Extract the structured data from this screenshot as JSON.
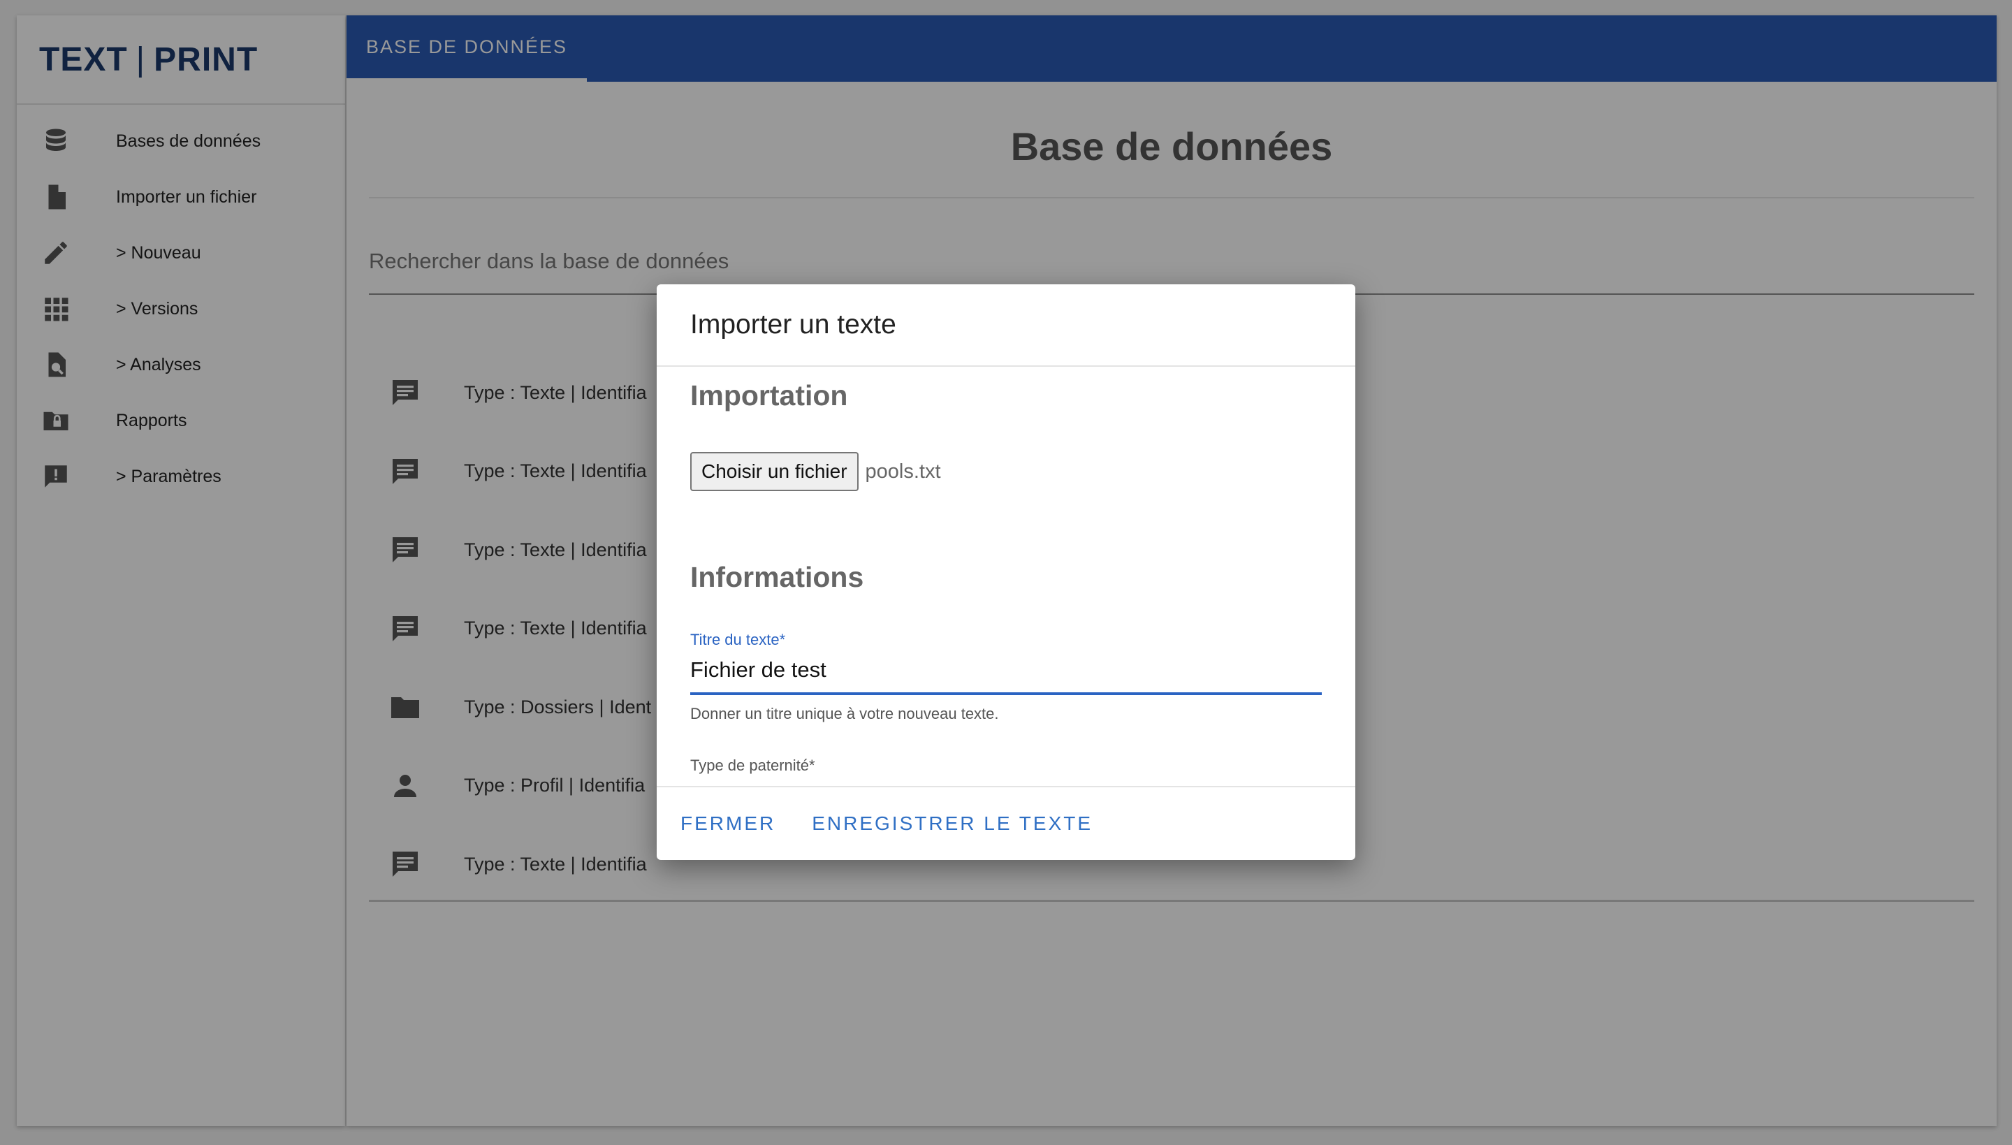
{
  "app": {
    "logo_left": "TEXT",
    "logo_sep": "|",
    "logo_right": "PRINT"
  },
  "sidebar": {
    "items": [
      {
        "label": "Bases de données",
        "icon": "database-icon"
      },
      {
        "label": "Importer un fichier",
        "icon": "file-icon"
      },
      {
        "label": "> Nouveau",
        "icon": "pencil-icon"
      },
      {
        "label": "> Versions",
        "icon": "grid-icon"
      },
      {
        "label": "> Analyses",
        "icon": "search-document-icon"
      },
      {
        "label": "Rapports",
        "icon": "locked-folder-icon"
      },
      {
        "label": "> Paramètres",
        "icon": "alert-message-icon"
      }
    ]
  },
  "header": {
    "tab_label": "BASE DE DONNÉES"
  },
  "main": {
    "title": "Base de données",
    "search_placeholder": "Rechercher dans la base de données",
    "rows": [
      {
        "text": "Type : Texte | Identifia",
        "icon": "comment-icon"
      },
      {
        "text": "Type : Texte | Identifia",
        "icon": "comment-icon"
      },
      {
        "text": "Type : Texte | Identifia",
        "icon": "comment-icon"
      },
      {
        "text": "Type : Texte | Identifia",
        "icon": "comment-icon"
      },
      {
        "text": "Type : Dossiers | Ident",
        "icon": "folder-icon"
      },
      {
        "text": "Type : Profil | Identifia",
        "icon": "person-icon"
      },
      {
        "text": "Type : Texte | Identifia",
        "icon": "comment-icon"
      }
    ]
  },
  "dialog": {
    "title": "Importer un texte",
    "section_import": "Importation",
    "file_button": "Choisir un fichier",
    "file_name": "pools.txt",
    "section_info": "Informations",
    "title_field_label": "Titre du texte*",
    "title_field_value": "Fichier de test",
    "title_field_hint": "Donner un titre unique à votre nouveau texte.",
    "paternity_label": "Type de paternité*",
    "close_button": "FERMER",
    "save_button": "ENREGISTRER LE TEXTE"
  },
  "colors": {
    "brand": "#1b3a6b",
    "appbar": "#2a5bb5",
    "accent": "#2f6fc4"
  }
}
